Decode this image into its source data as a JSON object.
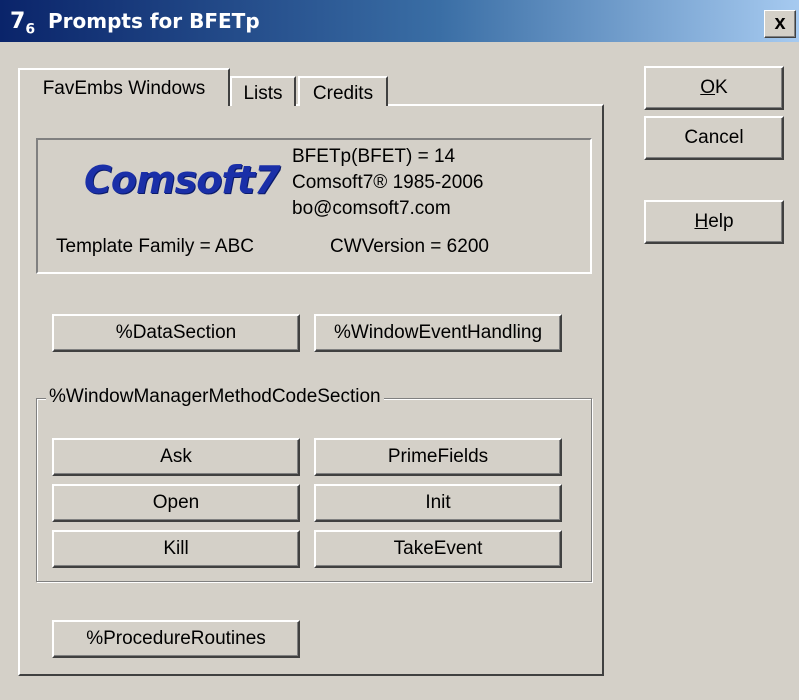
{
  "window": {
    "title": "Prompts for BFETp",
    "icon_text": "7",
    "icon_sub": "6",
    "close_label": "x"
  },
  "tabs": [
    {
      "label": "FavEmbs Windows",
      "active": true
    },
    {
      "label": "Lists",
      "active": false
    },
    {
      "label": "Credits",
      "active": false
    }
  ],
  "info": {
    "logo_text": "Comsoft7",
    "line1": "BFETp(BFET) = 14",
    "line2": "Comsoft7® 1985-2006",
    "line3": "bo@comsoft7.com",
    "template_family": "Template Family = ABC",
    "cw_version": "CWVersion = 6200"
  },
  "embed_buttons": {
    "data_section": "%DataSection",
    "window_event_handling": "%WindowEventHandling",
    "procedure_routines": "%ProcedureRoutines"
  },
  "wm_group": {
    "label": "%WindowManagerMethodCodeSection",
    "buttons": {
      "ask": "Ask",
      "prime_fields": "PrimeFields",
      "open": "Open",
      "init": "Init",
      "kill": "Kill",
      "take_event": "TakeEvent"
    }
  },
  "side_buttons": {
    "ok_mnemonic": "O",
    "ok_rest": "K",
    "cancel": "Cancel",
    "help_mnemonic": "H",
    "help_rest": "elp"
  },
  "colors": {
    "title_gradient_start": "#0a246a",
    "title_gradient_end": "#a6caf0",
    "face": "#d4d0c8",
    "logo": "#1a2fa8"
  }
}
